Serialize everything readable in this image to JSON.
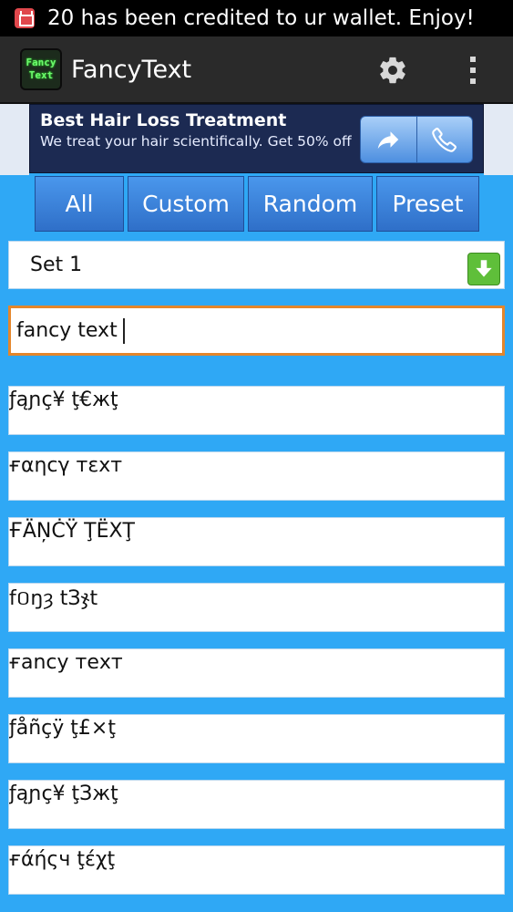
{
  "status_bar": {
    "notification_text": "20 has been credited to ur wallet. Enjoy!",
    "notification_icon": "calendar-icon"
  },
  "action_bar": {
    "app_icon_line1": "Fancy",
    "app_icon_line2": "Text",
    "title": "FancyText",
    "settings_icon": "gear-icon",
    "overflow_icon": "overflow-menu-icon"
  },
  "ad": {
    "title": "Best Hair Loss Treatment",
    "subtitle": "We treat your hair scientifically. Get 50% off",
    "share_icon": "share-arrow-icon",
    "call_icon": "phone-icon"
  },
  "tabs": [
    {
      "label": "All"
    },
    {
      "label": "Custom"
    },
    {
      "label": "Random"
    },
    {
      "label": "Preset"
    }
  ],
  "set_selector": {
    "selected": "Set 1",
    "icon": "download-arrow-icon"
  },
  "input": {
    "value": "fancy text"
  },
  "results": [
    "ƒąɲç¥ ţ€жţ",
    "ғαηcγ тεхт",
    "ҒÄŅĊŸ ŢЁΧŢ",
    "f០ŋȝ tЗჯt",
    "ғancy тeхт",
    "ƒåñçÿ ţ£×ţ",
    "ƒąɲç¥ ţЗжţ",
    "ғάήςч ţέχţ"
  ],
  "colors": {
    "background": "#2fa8f5",
    "action_bar": "#2a2a2a",
    "tab": "#3b82dc",
    "input_focus": "#e4862b",
    "dropdown_arrow": "#5fbf3a",
    "ad_background": "#1c2a52"
  }
}
